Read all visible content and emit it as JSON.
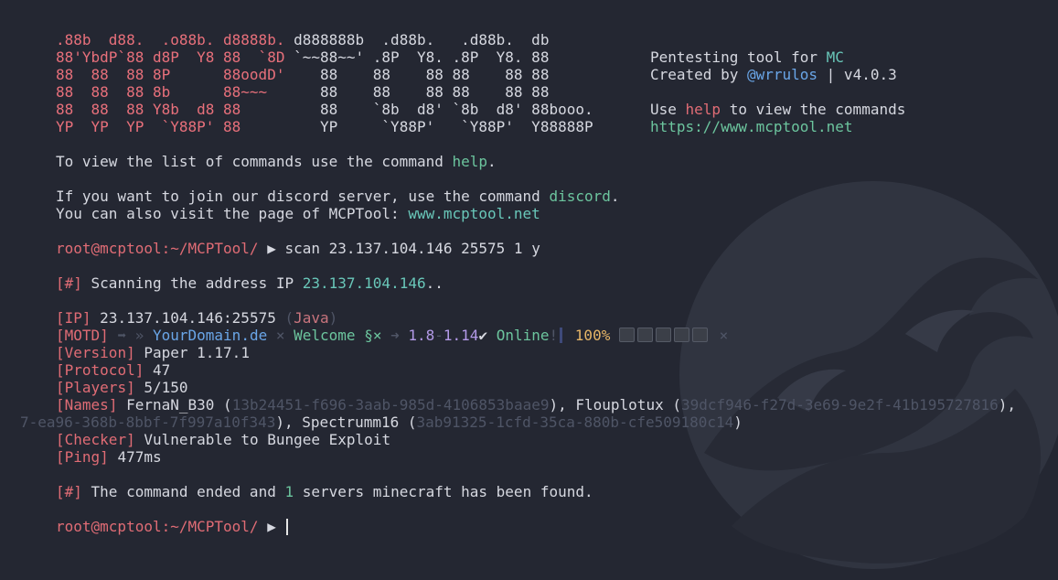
{
  "banner": {
    "ascii": [
      [
        ".88b  d88.  .o88b. d8888b. ",
        "d888888b  .d88b.   .d88b.  db"
      ],
      [
        "88'YbdP`88 d8P  Y8 88  `8D ",
        "`~~88~~' .8P  Y8. .8P  Y8. 88"
      ],
      [
        "88  88  88 8P      88oodD' ",
        "   88    88    88 88    88 88"
      ],
      [
        "88  88  88 8b      88~~~   ",
        "   88    88    88 88    88 88"
      ],
      [
        "88  88  88 Y8b  d8 88      ",
        "   88    `8b  d8' `8b  d8' 88booo."
      ],
      [
        "YP  YP  YP  `Y88P' 88      ",
        "   YP     `Y88P'   `Y88P'  Y88888P"
      ]
    ],
    "info_tool_prefix": "Pentesting tool for ",
    "info_tool_mc": "MC",
    "info_created_prefix": "Created by ",
    "info_author": "@wrrulos",
    "info_version": " | v4.0.3",
    "info_use_prefix": "Use ",
    "info_help": "help",
    "info_use_suffix": " to view the commands",
    "info_url": "https://www.mcptool.net"
  },
  "intro": {
    "list_prefix": "To view the list of commands use the command ",
    "list_cmd": "help",
    "list_suffix": ".",
    "discord_prefix": "If you want to join our discord server, use the command ",
    "discord_cmd": "discord",
    "discord_suffix": ".",
    "visit_prefix": "You can also visit the page of MCPTool: ",
    "visit_url": "www.mcptool.net"
  },
  "prompt": {
    "path": "root@mcptool:~/MCPTool/",
    "arrow": " ▶ ",
    "command": "scan 23.137.104.146 25575 1 y"
  },
  "scan": {
    "scanning_tag": "[#]",
    "scanning_prefix": " Scanning the address IP ",
    "scanning_ip": "23.137.104.146",
    "scanning_suffix": "..",
    "ip_label": "IP",
    "ip_value": " 23.137.104.146:25575 ",
    "ip_edition_open": "(",
    "ip_edition": "Java",
    "ip_edition_close": ")",
    "motd_label": "MOTD",
    "motd_arrows": " ➡ » ",
    "motd_domain": "YourDomain.de",
    "motd_x1": " × ",
    "motd_welcome": "Welcome §×",
    "motd_arrow2": " ➜ ",
    "motd_ver": "1.8",
    "motd_dash": "-",
    "motd_ver2": "1.14",
    "motd_check": "✔",
    "motd_online": " Online",
    "motd_excl": "!",
    "motd_percent": "100%",
    "motd_x2": " ×",
    "version_label": "Version",
    "version_value": " Paper 1.17.1",
    "protocol_label": "Protocol",
    "protocol_value": " 47",
    "players_label": "Players",
    "players_value": " 5/150",
    "names_label": "Names",
    "names_line1": [
      {
        "name": " FernaN_B30 ",
        "uuid": "13b24451-f696-3aab-985d-4106853baae9",
        "sep": "), "
      },
      {
        "name": "Flouplotux ",
        "uuid": "39dcf946-f27d-3e69-9e2f-41b195727816",
        "sep": "),"
      }
    ],
    "names_line2_uuid_tail": "7-ea96-368b-8bbf-7f997a10f343",
    "names_line2_sep": "), ",
    "names_line2_name": "Spectrumm16 ",
    "names_line2_uuid": "3ab91325-1cfd-35ca-880b-cfe509180c14",
    "names_line2_close": ")",
    "checker_label": "Checker",
    "checker_value": " Vulnerable to Bungee Exploit",
    "ping_label": "Ping",
    "ping_value": " 477ms",
    "end_tag": "[#]",
    "end_prefix": " The command ended and ",
    "end_count": "1",
    "end_suffix": " servers minecraft has been found."
  },
  "prompt2": {
    "path": "root@mcptool:~/MCPTool/",
    "arrow": " ▶ "
  },
  "colors": {
    "background": "#242732",
    "red": "#e06c75",
    "green": "#6cc59e",
    "blue": "#6aa6e8",
    "yellow": "#e5b567",
    "purple": "#b39ae8"
  },
  "icons": {
    "background_art": "great-wave-icon",
    "progress_blocks": "block-icon"
  }
}
